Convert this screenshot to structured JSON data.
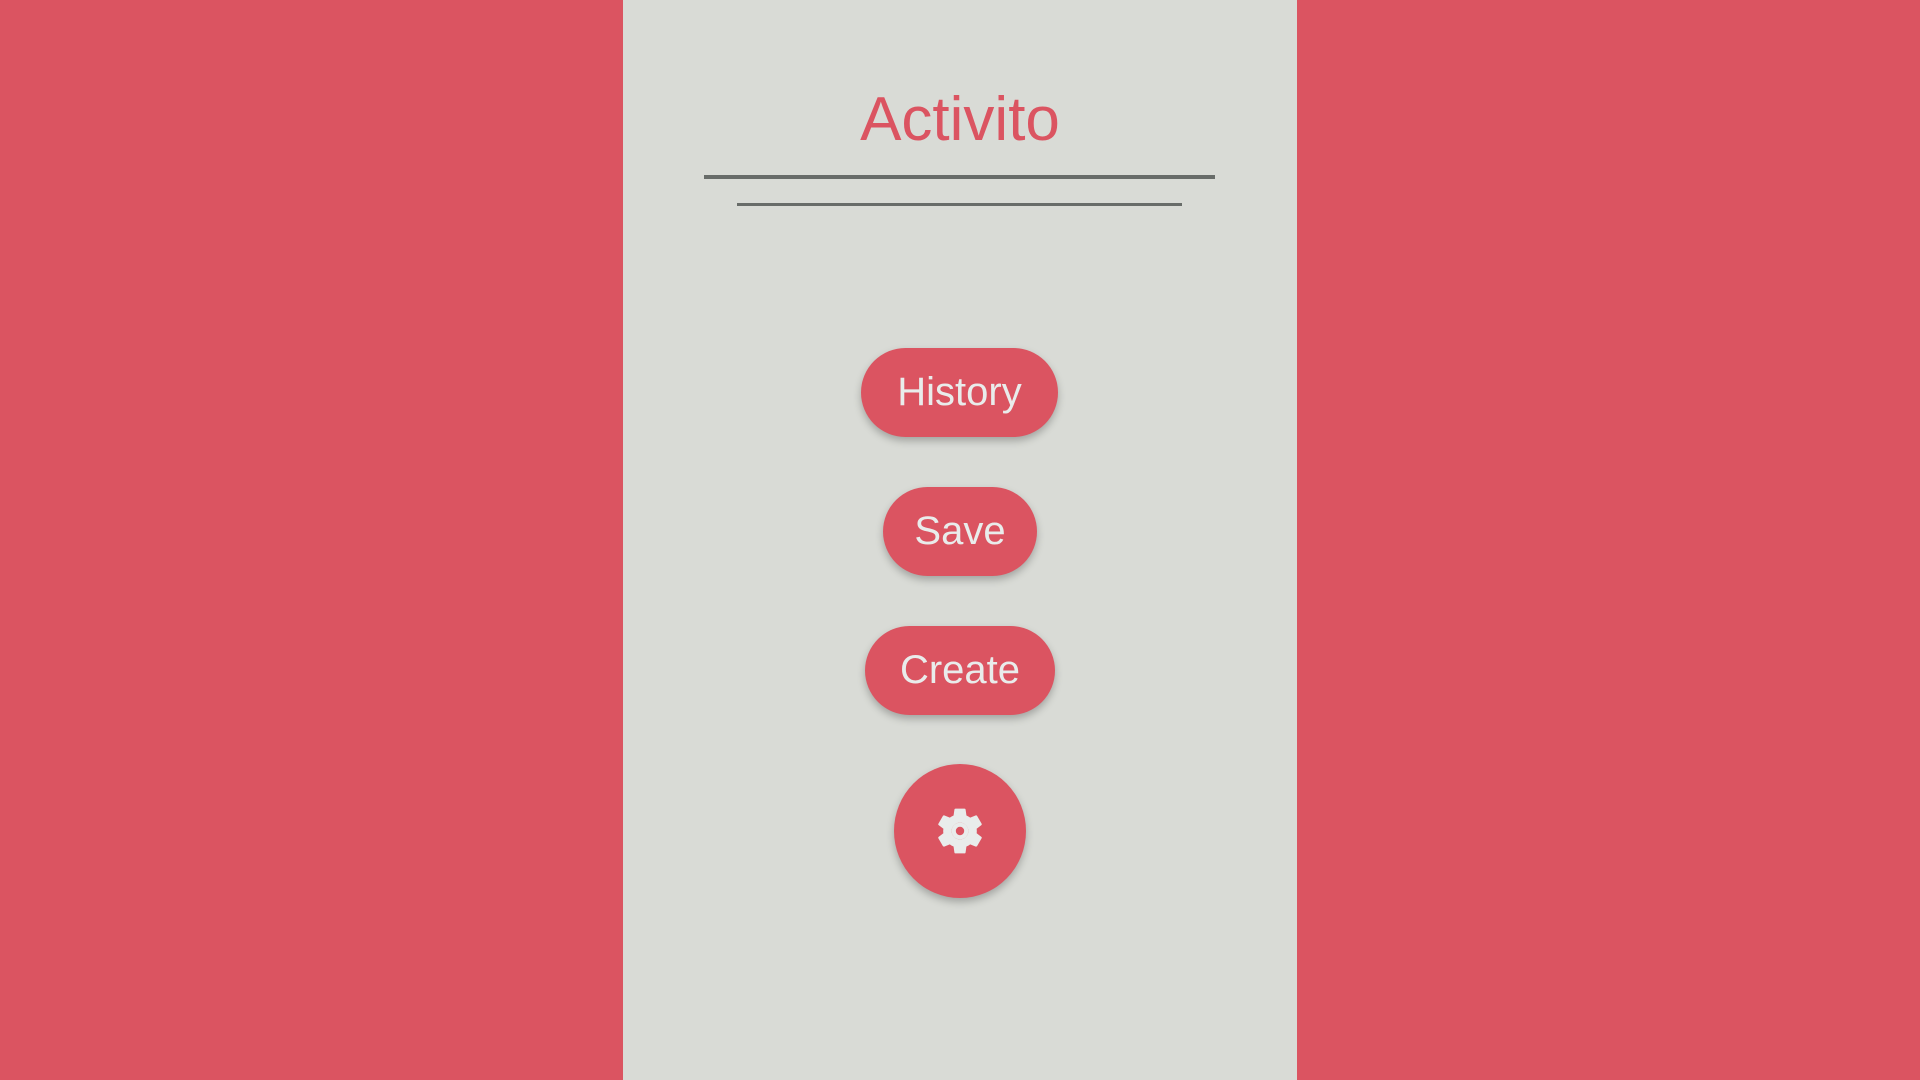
{
  "app": {
    "title": "Activito"
  },
  "menu": {
    "history_label": "History",
    "save_label": "Save",
    "create_label": "Create",
    "settings_icon": "gear-icon"
  },
  "colors": {
    "background": "#DB5461",
    "panel": "#D9DBD6",
    "accent": "#DB5461",
    "button_text": "#E9ECEB",
    "rule": "#686C69"
  }
}
